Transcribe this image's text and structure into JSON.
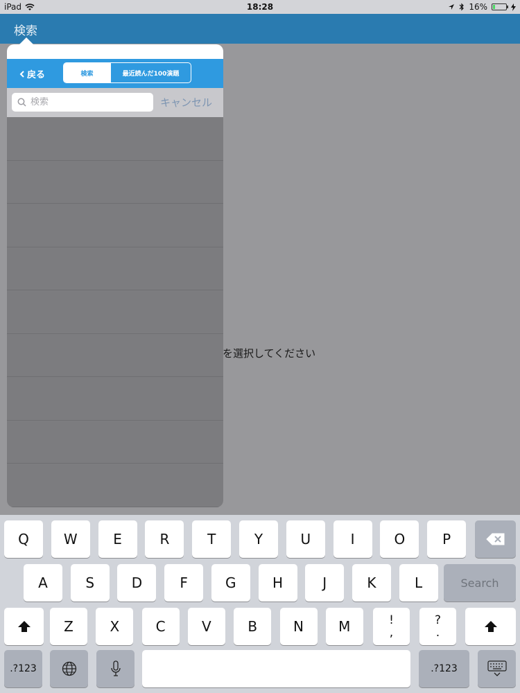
{
  "status_bar": {
    "device": "iPad",
    "time": "18:28",
    "battery_percent": "16%",
    "battery_level": 0.16
  },
  "nav": {
    "title": "検索"
  },
  "detail": {
    "message": "を選択してください"
  },
  "popover": {
    "back_label": "戻る",
    "segments": [
      "検索",
      "最近読んだ100演題"
    ],
    "search_placeholder": "検索",
    "search_value": "",
    "cancel_label": "キャンセル",
    "row_count": 9
  },
  "keyboard": {
    "row1": [
      "Q",
      "W",
      "E",
      "R",
      "T",
      "Y",
      "U",
      "I",
      "O",
      "P"
    ],
    "row2": [
      "A",
      "S",
      "D",
      "F",
      "G",
      "H",
      "J",
      "K",
      "L"
    ],
    "row3": [
      "Z",
      "X",
      "C",
      "V",
      "B",
      "N",
      "M"
    ],
    "punct1": [
      "!",
      ","
    ],
    "punct2": [
      "?",
      "."
    ],
    "search_label": "Search",
    "numbers_label": ".?123"
  },
  "colors": {
    "nav_bar": "#2a7bb0",
    "popover_header": "#2f9ae0",
    "keyboard_bg": "#d1d4da"
  },
  "icons": [
    "wifi-icon",
    "location-icon",
    "bluetooth-icon",
    "battery-icon",
    "charging-icon",
    "search-icon",
    "backspace-icon",
    "shift-icon",
    "globe-icon",
    "microphone-icon",
    "keyboard-dismiss-icon",
    "chevron-left-icon"
  ]
}
